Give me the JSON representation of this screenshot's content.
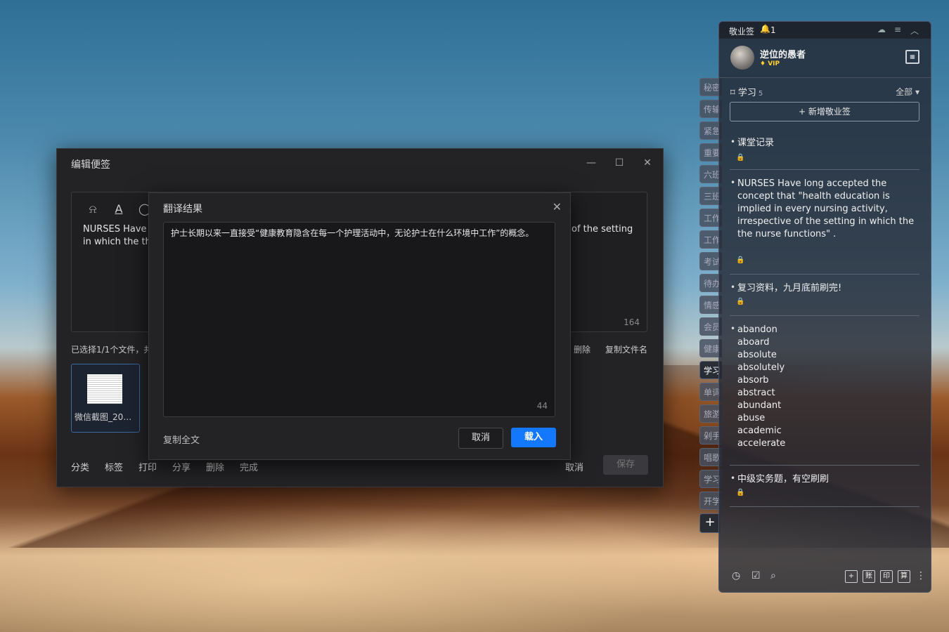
{
  "edit_window": {
    "title": "编辑便签",
    "content": "NURSES Have l",
    "content_line2": "in which the th",
    "content_right": "of the setting",
    "char_count": "164",
    "files_info": "已选择1/1个文件，共",
    "delete_file": "删除",
    "copy_filename": "复制文件名",
    "file_name": "微信截图_202...",
    "bottom_actions": [
      "分类",
      "标签",
      "打印",
      "分享",
      "删除",
      "完成"
    ],
    "cancel": "取消",
    "save": "保存"
  },
  "translate_dialog": {
    "title": "翻译结果",
    "text": "护士长期以来一直接受“健康教育隐含在每一个护理活动中，无论护士在什么环境中工作”的概念。",
    "char_count": "44",
    "copy_all": "复制全文",
    "cancel": "取消",
    "load": "载入"
  },
  "category_tabs": [
    "秘密",
    "传输",
    "紧急",
    "重要",
    "六班",
    "三班",
    "工作",
    "工作",
    "考试",
    "待办",
    "情感",
    "会员",
    "健康",
    "学习",
    "单词",
    "旅游",
    "剁手",
    "唱歌",
    "学习",
    "开学"
  ],
  "active_tab_index": 13,
  "panel": {
    "brand": "敬业签",
    "notification_count": "1",
    "username": "逆位的愚者",
    "vip": "VIP",
    "category": "学习",
    "category_count": "5",
    "filter": "全部",
    "new_note": "新增敬业签",
    "notes": [
      {
        "text": "课堂记录"
      },
      {
        "text": "NURSES Have long accepted the concept that \"health education is implied in every nursing activity, irrespective of the setting in which the the nurse functions\" ."
      },
      {
        "text": "复习资料，九月底前刷完!"
      },
      {
        "text": "abandon\naboard\nabsolute\nabsolutely\nabsorb\nabstract\nabundant\nabuse\nacademic\naccelerate"
      },
      {
        "text": "中级实务题，有空刷刷"
      }
    ],
    "footer_boxes": [
      "+",
      "账",
      "印",
      "算"
    ]
  },
  "colors": {
    "accent_blue": "#1478ff",
    "vip_gold": "#ffce2a",
    "dialog_bg": "#232326"
  }
}
